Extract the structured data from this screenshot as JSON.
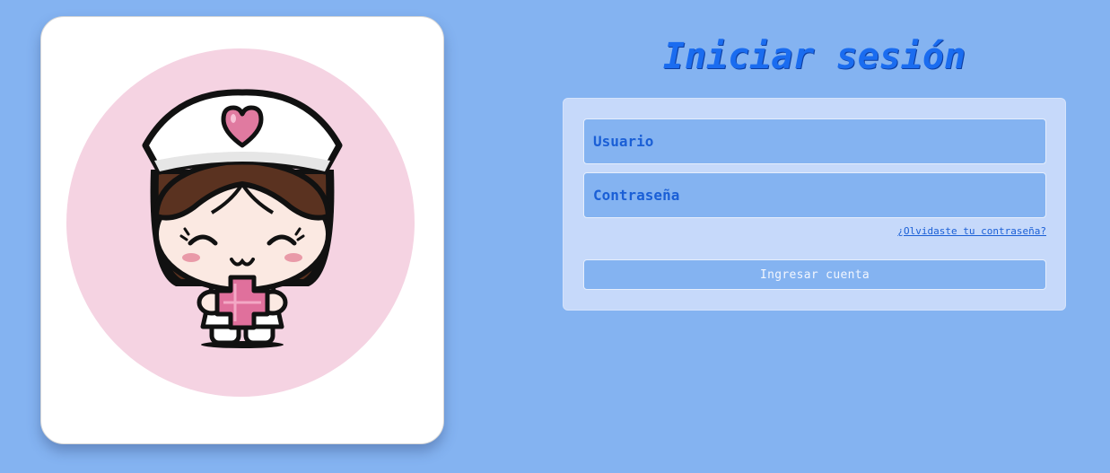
{
  "login": {
    "title": "Iniciar sesión",
    "username_placeholder": "Usuario",
    "password_placeholder": "Contraseña",
    "forgot_password": "¿Olvidaste tu contraseña?",
    "submit_label": "Ingresar cuenta"
  },
  "illustration": {
    "icon": "nurse-avatar-icon",
    "description_icons": [
      "heart-icon",
      "medical-cross-icon"
    ]
  },
  "colors": {
    "background": "#84b3f1",
    "panel": "#c6d9fa",
    "accent": "#1a6cf0",
    "circle_pink": "#f5d3e2",
    "heart_pink": "#e07aa0"
  }
}
